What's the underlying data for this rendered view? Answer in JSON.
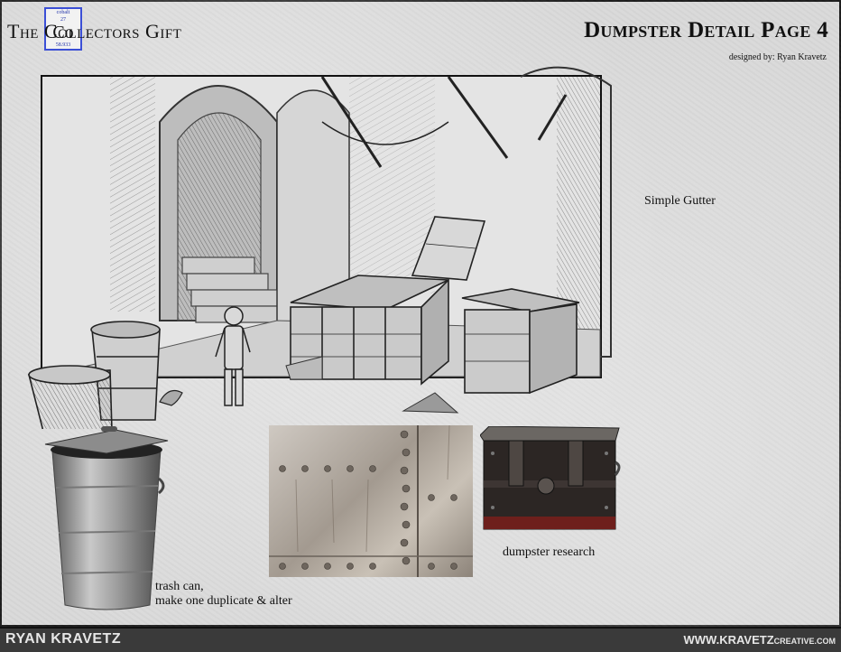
{
  "header": {
    "title_left": "The Collectors Gift",
    "element_badge": {
      "name": "cobalt",
      "number": "27",
      "symbol": "Co",
      "mass": "58.933"
    },
    "title_right": "Dumpster Detail Page 4",
    "designer": "designed by: Ryan Kravetz"
  },
  "notes": {
    "gutter": "Simple Gutter",
    "trash_line1": "trash can,",
    "trash_line2": "make one duplicate  & alter",
    "research": "dumpster research"
  },
  "footer": {
    "name": "RYAN KRAVETZ",
    "site_main": "WWW.KRAVETZ",
    "site_suffix": "CREATIVE.COM"
  },
  "colors": {
    "paper": "#d9d9d9",
    "footer_bg": "#3a3a3a",
    "badge_border": "#3b4fd6"
  }
}
